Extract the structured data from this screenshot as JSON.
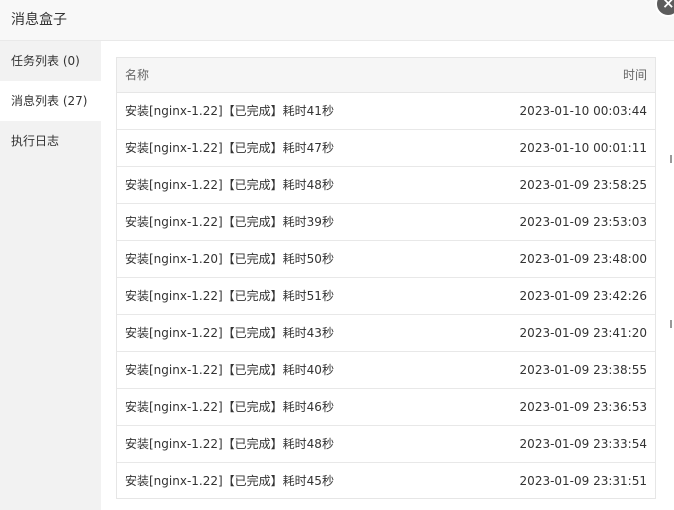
{
  "dialog": {
    "title": "消息盒子",
    "close_icon": "close-icon"
  },
  "sidebar": {
    "items": [
      {
        "label": "任务列表 (0)",
        "active": false
      },
      {
        "label": "消息列表 (27)",
        "active": true
      },
      {
        "label": "执行日志",
        "active": false
      }
    ]
  },
  "table": {
    "headers": {
      "name": "名称",
      "time": "时间"
    },
    "rows": [
      {
        "name": "安装[nginx-1.22]【已完成】耗时41秒",
        "time": "2023-01-10 00:03:44"
      },
      {
        "name": "安装[nginx-1.22]【已完成】耗时47秒",
        "time": "2023-01-10 00:01:11"
      },
      {
        "name": "安装[nginx-1.22]【已完成】耗时48秒",
        "time": "2023-01-09 23:58:25"
      },
      {
        "name": "安装[nginx-1.22]【已完成】耗时39秒",
        "time": "2023-01-09 23:53:03"
      },
      {
        "name": "安装[nginx-1.20]【已完成】耗时50秒",
        "time": "2023-01-09 23:48:00"
      },
      {
        "name": "安装[nginx-1.22]【已完成】耗时51秒",
        "time": "2023-01-09 23:42:26"
      },
      {
        "name": "安装[nginx-1.22]【已完成】耗时43秒",
        "time": "2023-01-09 23:41:20"
      },
      {
        "name": "安装[nginx-1.22]【已完成】耗时40秒",
        "time": "2023-01-09 23:38:55"
      },
      {
        "name": "安装[nginx-1.22]【已完成】耗时46秒",
        "time": "2023-01-09 23:36:53"
      },
      {
        "name": "安装[nginx-1.22]【已完成】耗时48秒",
        "time": "2023-01-09 23:33:54"
      },
      {
        "name": "安装[nginx-1.22]【已完成】耗时45秒",
        "time": "2023-01-09 23:31:51"
      }
    ]
  },
  "colors": {
    "sidebar_bg": "#f2f2f2",
    "header_bg": "#f6f6f6",
    "close_bg": "#5c5c5c"
  }
}
